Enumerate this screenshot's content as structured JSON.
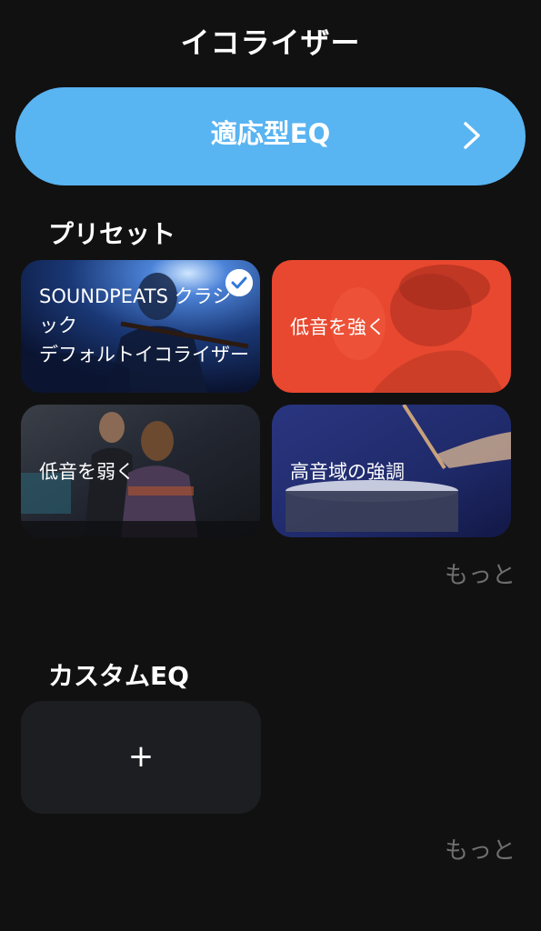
{
  "header": {
    "title": "イコライザー"
  },
  "adaptive": {
    "label": "適応型EQ",
    "icon": "chevron-right-icon",
    "color": "#59b4f2"
  },
  "presets": {
    "section_title": "プリセット",
    "items": [
      {
        "line1": "SOUNDPEATS クラシ",
        "line2": "ック",
        "line3": "デフォルトイコライザー",
        "selected": true
      },
      {
        "line1": "低音を強く",
        "selected": false
      },
      {
        "line1": "低音を弱く",
        "selected": false
      },
      {
        "line1": "高音域の強調",
        "selected": false
      }
    ],
    "more_label": "もっと"
  },
  "custom": {
    "section_title": "カスタムEQ",
    "add_symbol": "+",
    "more_label": "もっと"
  }
}
